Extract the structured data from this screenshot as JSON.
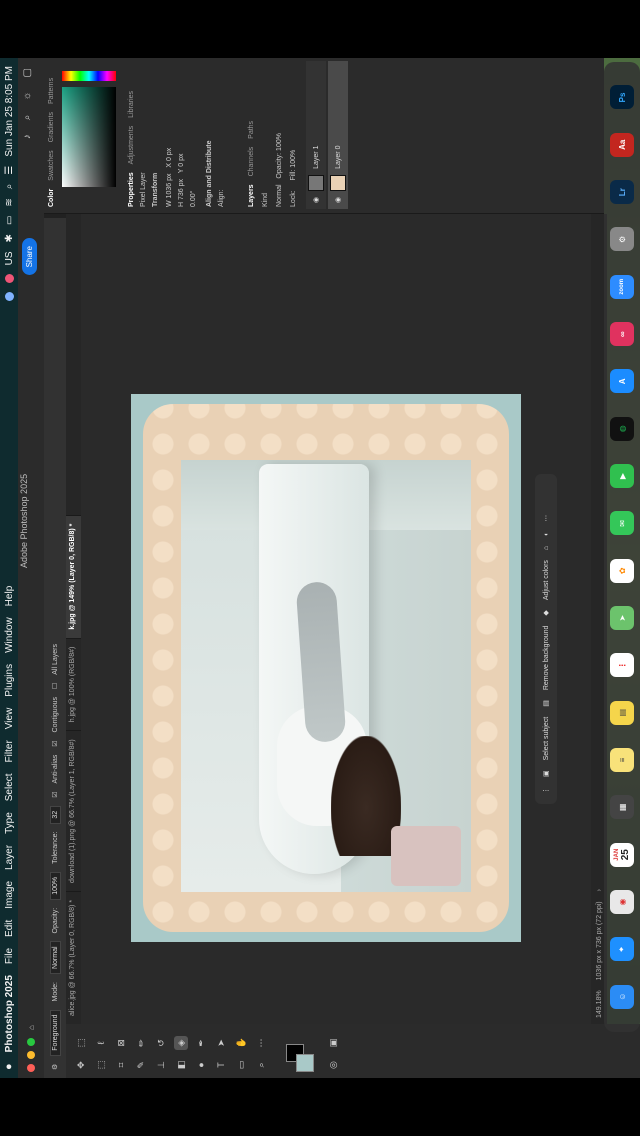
{
  "menubar": {
    "apple": "",
    "app_name": "Photoshop 2025",
    "items": [
      "File",
      "Edit",
      "Image",
      "Layer",
      "Type",
      "Select",
      "Filter",
      "View",
      "Plugins",
      "Window",
      "Help"
    ],
    "datetime": "Sun Jan 25  8:05 PM",
    "status_text": "US"
  },
  "appbar": {
    "title": "Adobe Photoshop 2025",
    "share_label": "Share"
  },
  "options": {
    "sample": "Foreground",
    "mode_label": "Mode:",
    "mode_value": "Normal",
    "opacity_label": "Opacity:",
    "opacity_value": "100%",
    "tolerance_label": "Tolerance:",
    "tolerance_value": "32",
    "antialias_label": "Anti-alias",
    "contiguous_label": "Contiguous",
    "all_layers_label": "All Layers"
  },
  "tabs": [
    {
      "label": "alice.jpg @ 66.7% (Layer 0, RGB/8) *"
    },
    {
      "label": "download (1).png @ 66.7% (Layer 1, RGB/8#)"
    },
    {
      "label": "h.jpg @ 100% (RGB/8#)"
    },
    {
      "label": "k.jpg @ 149% (Layer 0, RGB/8) *"
    }
  ],
  "context_bar": {
    "select_subject": "Select subject",
    "remove_background": "Remove background",
    "adjust_colors": "Adjust colors"
  },
  "status": {
    "zoom": "149.18%",
    "doc_size": "1036 px x 736 px (72 ppi)"
  },
  "panels": {
    "color_tabs": [
      "Color",
      "Swatches",
      "Gradients",
      "Patterns"
    ],
    "props_tabs": [
      "Properties",
      "Adjustments",
      "Libraries"
    ],
    "pixel_layer": "Pixel Layer",
    "transform_title": "Transform",
    "w_label": "W",
    "w_value": "1036 px",
    "h_label": "H",
    "h_value": "736 px",
    "x_label": "X",
    "x_value": "0 px",
    "y_label": "Y",
    "y_value": "0 px",
    "angle_value": "0.00°",
    "align_title": "Align and Distribute",
    "align_label": "Align:",
    "layer_tabs": [
      "Layers",
      "Channels",
      "Paths"
    ],
    "kind_label": "Kind",
    "blend_value": "Normal",
    "opacity_label": "Opacity:",
    "opacity_value": "100%",
    "lock_label": "Lock:",
    "fill_label": "Fill:",
    "fill_value": "100%",
    "layers": [
      {
        "name": "Layer 1"
      },
      {
        "name": "Layer 0"
      }
    ]
  },
  "dock": {
    "icons": [
      "finder-icon",
      "safari-icon",
      "chrome-icon",
      "calendar-icon",
      "calculator-icon",
      "notes-icon",
      "stickies-icon",
      "reminders-icon",
      "maps-icon",
      "photos-icon",
      "messages-icon",
      "facetime-icon",
      "spotify-icon",
      "appstore-icon",
      "creative-cloud-icon",
      "zoom-icon",
      "system-settings-icon",
      "lightroom-icon",
      "acrobat-icon",
      "photoshop-icon"
    ],
    "calendar_date": "25",
    "calendar_month": "JAN",
    "lr_label": "Lr",
    "ps_label": "Ps",
    "zoom_label": "zoom"
  },
  "colors": {
    "accent": "#1473e6",
    "canvas_bg": "#a9c9c8",
    "lace": "#e9d1b5"
  }
}
